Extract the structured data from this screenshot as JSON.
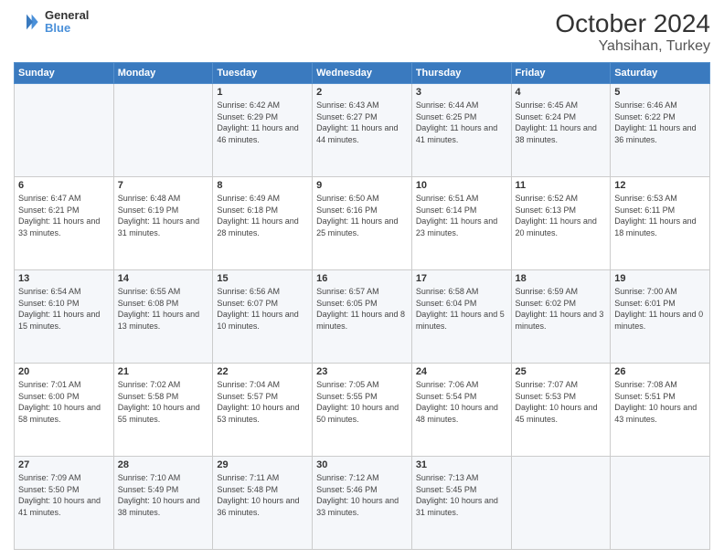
{
  "header": {
    "logo_line1": "General",
    "logo_line2": "Blue",
    "title": "October 2024",
    "subtitle": "Yahsihan, Turkey"
  },
  "columns": [
    "Sunday",
    "Monday",
    "Tuesday",
    "Wednesday",
    "Thursday",
    "Friday",
    "Saturday"
  ],
  "weeks": [
    [
      {
        "day": "",
        "info": ""
      },
      {
        "day": "",
        "info": ""
      },
      {
        "day": "1",
        "info": "Sunrise: 6:42 AM\nSunset: 6:29 PM\nDaylight: 11 hours and 46 minutes."
      },
      {
        "day": "2",
        "info": "Sunrise: 6:43 AM\nSunset: 6:27 PM\nDaylight: 11 hours and 44 minutes."
      },
      {
        "day": "3",
        "info": "Sunrise: 6:44 AM\nSunset: 6:25 PM\nDaylight: 11 hours and 41 minutes."
      },
      {
        "day": "4",
        "info": "Sunrise: 6:45 AM\nSunset: 6:24 PM\nDaylight: 11 hours and 38 minutes."
      },
      {
        "day": "5",
        "info": "Sunrise: 6:46 AM\nSunset: 6:22 PM\nDaylight: 11 hours and 36 minutes."
      }
    ],
    [
      {
        "day": "6",
        "info": "Sunrise: 6:47 AM\nSunset: 6:21 PM\nDaylight: 11 hours and 33 minutes."
      },
      {
        "day": "7",
        "info": "Sunrise: 6:48 AM\nSunset: 6:19 PM\nDaylight: 11 hours and 31 minutes."
      },
      {
        "day": "8",
        "info": "Sunrise: 6:49 AM\nSunset: 6:18 PM\nDaylight: 11 hours and 28 minutes."
      },
      {
        "day": "9",
        "info": "Sunrise: 6:50 AM\nSunset: 6:16 PM\nDaylight: 11 hours and 25 minutes."
      },
      {
        "day": "10",
        "info": "Sunrise: 6:51 AM\nSunset: 6:14 PM\nDaylight: 11 hours and 23 minutes."
      },
      {
        "day": "11",
        "info": "Sunrise: 6:52 AM\nSunset: 6:13 PM\nDaylight: 11 hours and 20 minutes."
      },
      {
        "day": "12",
        "info": "Sunrise: 6:53 AM\nSunset: 6:11 PM\nDaylight: 11 hours and 18 minutes."
      }
    ],
    [
      {
        "day": "13",
        "info": "Sunrise: 6:54 AM\nSunset: 6:10 PM\nDaylight: 11 hours and 15 minutes."
      },
      {
        "day": "14",
        "info": "Sunrise: 6:55 AM\nSunset: 6:08 PM\nDaylight: 11 hours and 13 minutes."
      },
      {
        "day": "15",
        "info": "Sunrise: 6:56 AM\nSunset: 6:07 PM\nDaylight: 11 hours and 10 minutes."
      },
      {
        "day": "16",
        "info": "Sunrise: 6:57 AM\nSunset: 6:05 PM\nDaylight: 11 hours and 8 minutes."
      },
      {
        "day": "17",
        "info": "Sunrise: 6:58 AM\nSunset: 6:04 PM\nDaylight: 11 hours and 5 minutes."
      },
      {
        "day": "18",
        "info": "Sunrise: 6:59 AM\nSunset: 6:02 PM\nDaylight: 11 hours and 3 minutes."
      },
      {
        "day": "19",
        "info": "Sunrise: 7:00 AM\nSunset: 6:01 PM\nDaylight: 11 hours and 0 minutes."
      }
    ],
    [
      {
        "day": "20",
        "info": "Sunrise: 7:01 AM\nSunset: 6:00 PM\nDaylight: 10 hours and 58 minutes."
      },
      {
        "day": "21",
        "info": "Sunrise: 7:02 AM\nSunset: 5:58 PM\nDaylight: 10 hours and 55 minutes."
      },
      {
        "day": "22",
        "info": "Sunrise: 7:04 AM\nSunset: 5:57 PM\nDaylight: 10 hours and 53 minutes."
      },
      {
        "day": "23",
        "info": "Sunrise: 7:05 AM\nSunset: 5:55 PM\nDaylight: 10 hours and 50 minutes."
      },
      {
        "day": "24",
        "info": "Sunrise: 7:06 AM\nSunset: 5:54 PM\nDaylight: 10 hours and 48 minutes."
      },
      {
        "day": "25",
        "info": "Sunrise: 7:07 AM\nSunset: 5:53 PM\nDaylight: 10 hours and 45 minutes."
      },
      {
        "day": "26",
        "info": "Sunrise: 7:08 AM\nSunset: 5:51 PM\nDaylight: 10 hours and 43 minutes."
      }
    ],
    [
      {
        "day": "27",
        "info": "Sunrise: 7:09 AM\nSunset: 5:50 PM\nDaylight: 10 hours and 41 minutes."
      },
      {
        "day": "28",
        "info": "Sunrise: 7:10 AM\nSunset: 5:49 PM\nDaylight: 10 hours and 38 minutes."
      },
      {
        "day": "29",
        "info": "Sunrise: 7:11 AM\nSunset: 5:48 PM\nDaylight: 10 hours and 36 minutes."
      },
      {
        "day": "30",
        "info": "Sunrise: 7:12 AM\nSunset: 5:46 PM\nDaylight: 10 hours and 33 minutes."
      },
      {
        "day": "31",
        "info": "Sunrise: 7:13 AM\nSunset: 5:45 PM\nDaylight: 10 hours and 31 minutes."
      },
      {
        "day": "",
        "info": ""
      },
      {
        "day": "",
        "info": ""
      }
    ]
  ]
}
